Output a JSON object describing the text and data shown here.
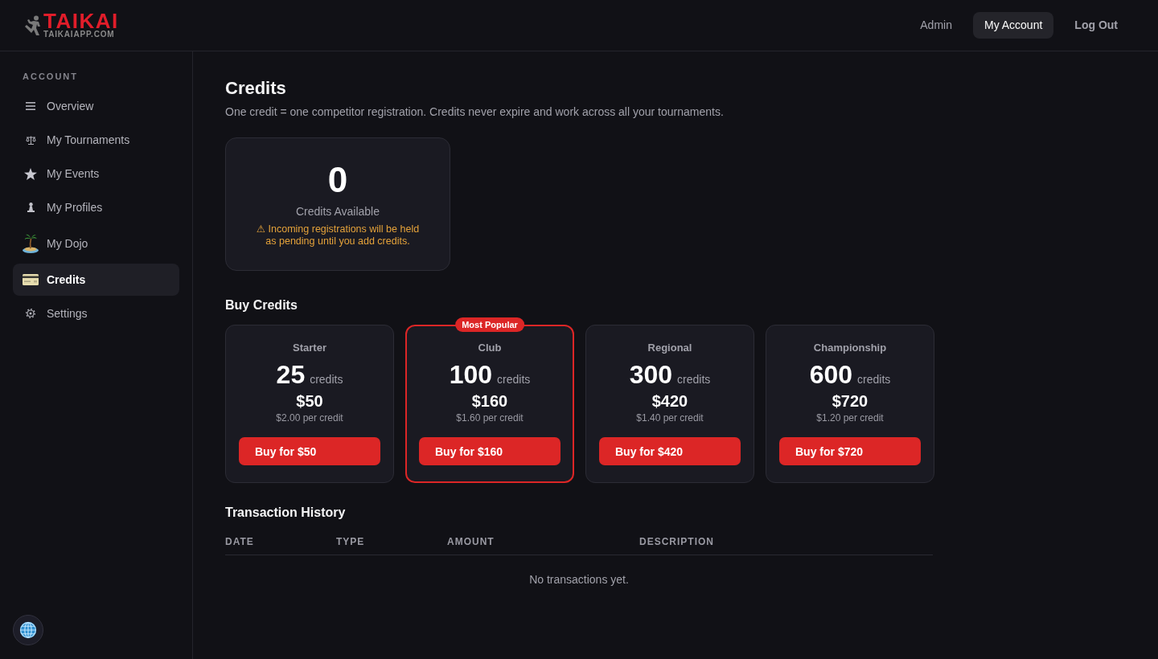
{
  "header": {
    "logo": {
      "wordmark": "TAIKAI",
      "domain": "TAIKAIAPP.COM"
    },
    "nav": [
      {
        "label": "Admin",
        "kind": "link",
        "selected": false
      },
      {
        "label": "My Account",
        "kind": "link",
        "selected": true
      },
      {
        "label": "Log Out",
        "kind": "action",
        "selected": false
      }
    ]
  },
  "sidebar": {
    "section": "ACCOUNT",
    "items": [
      {
        "label": "Overview",
        "selected": false
      },
      {
        "label": "My Tournaments",
        "selected": false
      },
      {
        "label": "My Events",
        "selected": false
      },
      {
        "label": "My Profiles",
        "selected": false
      },
      {
        "label": "My Dojo",
        "selected": false
      },
      {
        "label": "Credits",
        "selected": true
      },
      {
        "label": "Settings",
        "selected": false
      }
    ]
  },
  "page": {
    "title": "Credits",
    "subtitle": "One credit = one competitor registration. Credits never expire and work across all your tournaments."
  },
  "balance": {
    "amount": "0",
    "label": "Credits Available",
    "warning": "⚠ Incoming registrations will be held as pending until you add credits."
  },
  "buy_credits": {
    "title": "Buy Credits",
    "packages": [
      {
        "name": "Starter",
        "credits": "25",
        "unit": "credits",
        "price": "$50",
        "per_credit": "$2.00 per credit",
        "button": "Buy for $50",
        "featured": false
      },
      {
        "name": "Club",
        "badge": "Most Popular",
        "credits": "100",
        "unit": "credits",
        "price": "$160",
        "per_credit": "$1.60 per credit",
        "button": "Buy for $160",
        "featured": true
      },
      {
        "name": "Regional",
        "credits": "300",
        "unit": "credits",
        "price": "$420",
        "per_credit": "$1.40 per credit",
        "button": "Buy for $420",
        "featured": false
      },
      {
        "name": "Championship",
        "credits": "600",
        "unit": "credits",
        "price": "$720",
        "per_credit": "$1.20 per credit",
        "button": "Buy for $720",
        "featured": false
      }
    ]
  },
  "transactions": {
    "title": "Transaction History",
    "columns": [
      "DATE",
      "TYPE",
      "AMOUNT",
      "DESCRIPTION"
    ],
    "empty_message": "No transactions yet."
  }
}
